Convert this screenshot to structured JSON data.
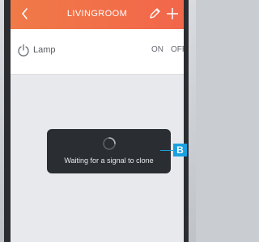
{
  "header": {
    "title": "LIVINGROOM",
    "back_icon": "chevron-left-icon",
    "edit_icon": "pencil-icon",
    "add_icon": "plus-icon",
    "color": "#f26f4a"
  },
  "device_row": {
    "icon": "power-icon",
    "name": "Lamp",
    "on_label": "ON",
    "off_label": "OFF"
  },
  "toast": {
    "icon": "loading-spinner-icon",
    "message": "Waiting for a signal to clone"
  },
  "callout": {
    "label": "B",
    "color": "#1aa0e0"
  }
}
